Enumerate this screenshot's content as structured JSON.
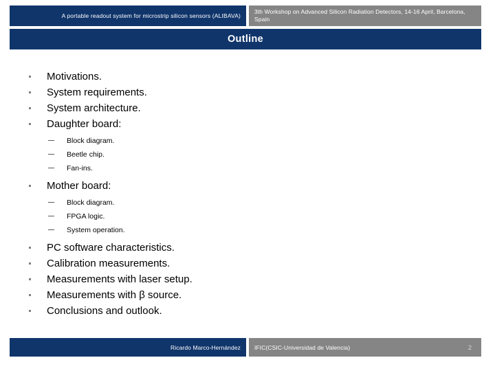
{
  "header": {
    "presentation_title": "A portable readout system for microstrip silicon sensors (ALIBAVA)",
    "event_info": "3th Workshop on Advanced Silicon Radiation Detectors, 14-16 April, Barcelona, Spain"
  },
  "slide": {
    "title": "Outline",
    "outline": [
      {
        "label": "Motivations.",
        "children": []
      },
      {
        "label": "System requirements.",
        "children": []
      },
      {
        "label": "System architecture.",
        "children": []
      },
      {
        "label": "Daughter board:",
        "children": [
          "Block diagram.",
          "Beetle chip.",
          "Fan-ins."
        ]
      },
      {
        "label": "Mother board:",
        "children": [
          "Block diagram.",
          "FPGA logic.",
          "System operation."
        ]
      },
      {
        "label": "PC software characteristics.",
        "children": []
      },
      {
        "label": "Calibration measurements.",
        "children": []
      },
      {
        "label": "Measurements with laser setup.",
        "children": []
      },
      {
        "label": "Measurements with β source.",
        "children": []
      },
      {
        "label": "Conclusions and outlook.",
        "children": []
      }
    ]
  },
  "footer": {
    "author": "Ricardo Marco-Hernández",
    "institution": "IFIC(CSIC-Universidad de Valencia)",
    "page_number": "2"
  },
  "colors": {
    "navy": "#10356b",
    "gray": "#858585",
    "background": "#ffffff",
    "text": "#000000",
    "bullet": "#808080"
  }
}
